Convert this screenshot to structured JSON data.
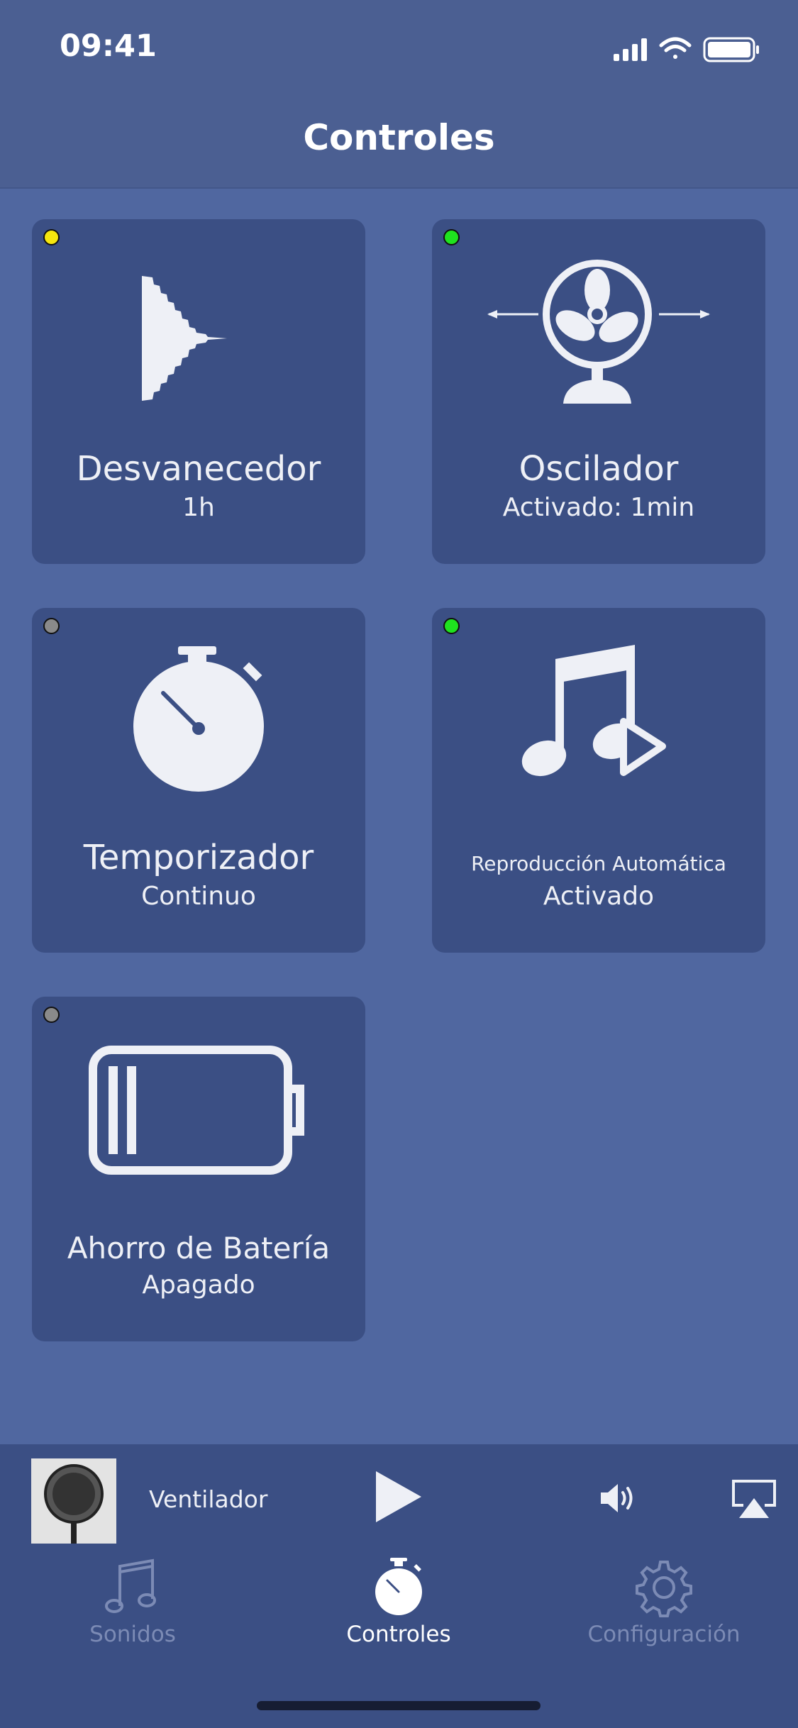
{
  "status_bar": {
    "time": "09:41"
  },
  "nav": {
    "title": "Controles"
  },
  "tiles": [
    {
      "title": "Desvanecedor",
      "subtitle": "1h",
      "indicator_color": "#f5e60e",
      "icon": "fade-waveform-icon"
    },
    {
      "title": "Oscilador",
      "subtitle": "Activado: 1min",
      "indicator_color": "#1fe31f",
      "icon": "fan-oscillate-icon"
    },
    {
      "title": "Temporizador",
      "subtitle": "Continuo",
      "indicator_color": "#8a8a8a",
      "icon": "stopwatch-icon"
    },
    {
      "title": "Reproducción Automática",
      "subtitle": "Activado",
      "indicator_color": "#1fe31f",
      "icon": "music-play-icon"
    },
    {
      "title": "Ahorro de Batería",
      "subtitle": "Apagado",
      "indicator_color": "#8a8a8a",
      "icon": "battery-icon"
    }
  ],
  "player": {
    "track": "Ventilador"
  },
  "tabs": [
    {
      "label": "Sonidos",
      "icon": "music-note-icon",
      "active": false
    },
    {
      "label": "Controles",
      "icon": "stopwatch-icon",
      "active": true
    },
    {
      "label": "Configuración",
      "icon": "gear-icon",
      "active": false
    }
  ],
  "colors": {
    "background": "#5067a0",
    "tile": "#3b4f84",
    "header": "#4b5f92"
  }
}
